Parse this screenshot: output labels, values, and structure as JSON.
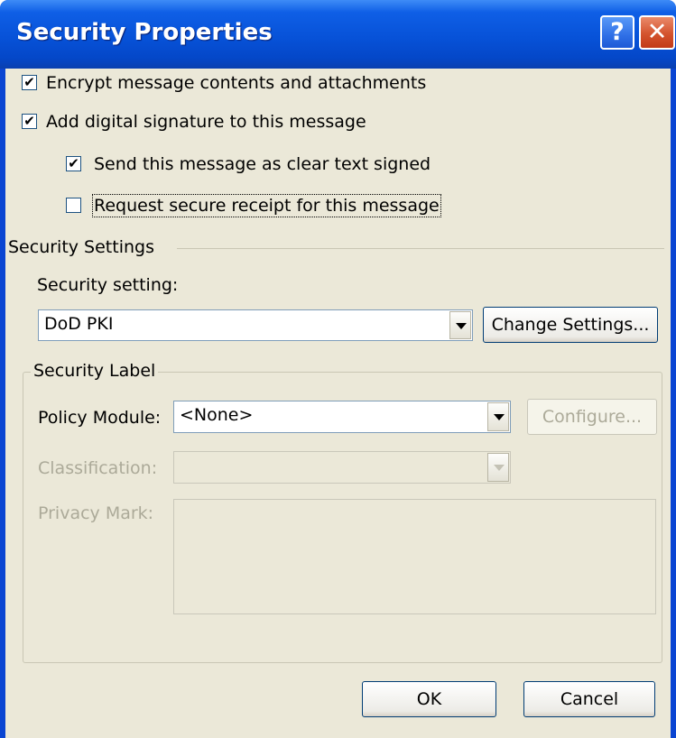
{
  "window": {
    "title": "Security Properties",
    "help_glyph": "?",
    "close_glyph": "✕"
  },
  "options": {
    "encrypt_label": "Encrypt message contents and attachments",
    "encrypt_checked": true,
    "sign_label": "Add digital signature to this message",
    "sign_checked": true,
    "clear_text_label": "Send this message as clear text signed",
    "clear_text_checked": true,
    "receipt_label": "Request secure receipt for this message",
    "receipt_checked": false
  },
  "security_settings": {
    "group_label": "Security Settings",
    "setting_label": "Security setting:",
    "setting_value": "DoD PKI",
    "change_button": "Change Settings..."
  },
  "security_label": {
    "group_label": "Security Label",
    "policy_label": "Policy Module:",
    "policy_value": "<None>",
    "configure_button": "Configure...",
    "classification_label": "Classification:",
    "classification_value": "",
    "privacy_label": "Privacy Mark:",
    "privacy_value": ""
  },
  "footer": {
    "ok_button": "OK",
    "cancel_button": "Cancel"
  },
  "icons": {
    "check": "✔"
  }
}
